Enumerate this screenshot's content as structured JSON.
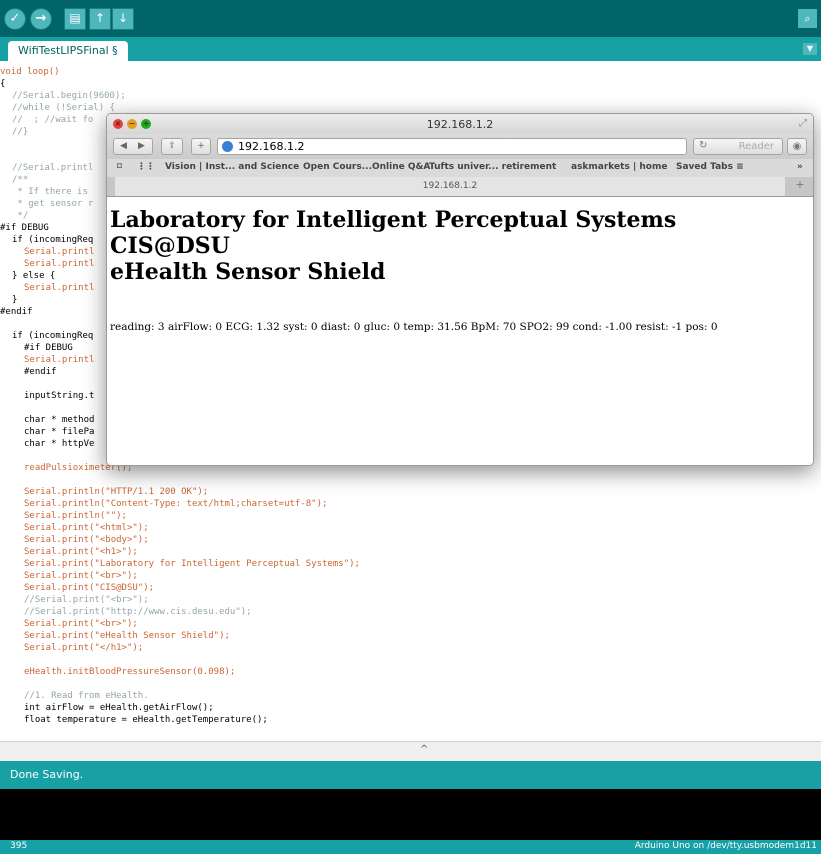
{
  "ide": {
    "toolbar_icons": [
      "verify-icon",
      "upload-icon",
      "new-icon",
      "open-icon",
      "save-icon",
      "serial-monitor-icon"
    ],
    "tab_label": "WifiTestLIPSFinal §",
    "status_message": "Done Saving.",
    "line_number": "395",
    "board_info": "Arduino Uno on /dev/tty.usbmodem1d11",
    "colors": {
      "toolbar": "#006468",
      "accent": "#17a1a5",
      "console": "#000000"
    }
  },
  "browser": {
    "window_title": "192.168.1.2",
    "url": "192.168.1.2",
    "reader_label": "Reader",
    "tab_title": "192.168.1.2",
    "bookmarks": [
      "Vision | Inst... and Science",
      "Open Cours...Online Q&A",
      "Tufts univer... retirement",
      "askmarkets | home",
      "Saved Tabs ≡"
    ],
    "page": {
      "heading1": "Laboratory for Intelligent Perceptual Systems",
      "heading2": "CIS@DSU",
      "heading3": "eHealth Sensor Shield",
      "reading": "reading: 3 airFlow: 0 ECG: 1.32 syst: 0 diast: 0 gluc: 0 temp: 31.56 BpM: 70 SPO2: 99 cond: -1.00 resist: -1 pos: 0"
    }
  }
}
